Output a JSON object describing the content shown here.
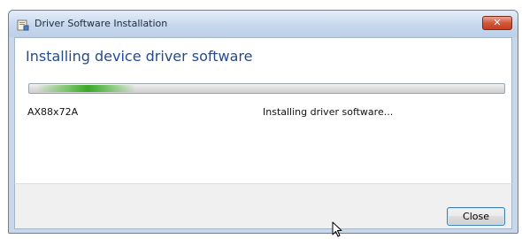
{
  "window": {
    "title": "Driver Software Installation",
    "close_icon": "close-icon"
  },
  "main": {
    "heading": "Installing device driver software",
    "progress": {
      "mode": "indeterminate",
      "color": "#39a828"
    },
    "device": {
      "name": "AX88x72A",
      "status": "Installing driver software..."
    }
  },
  "footer": {
    "close_label": "Close"
  },
  "colors": {
    "heading": "#254b8f",
    "titlebar": "#c7d8ed",
    "close_x": "#c3401f",
    "button_border": "#3c7fb1"
  }
}
